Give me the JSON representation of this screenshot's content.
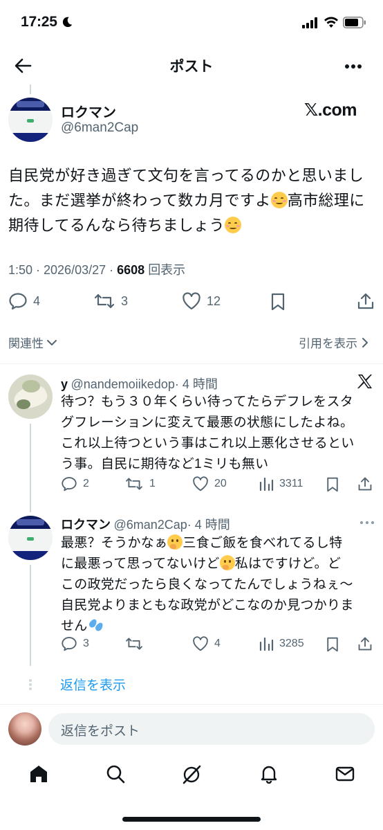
{
  "status_bar": {
    "time": "17:25"
  },
  "header": {
    "title": "ポスト"
  },
  "main_post": {
    "display_name": "ロクマン",
    "handle": "@6man2Cap",
    "source_label": "𝕏.com",
    "text_line1": "自民党が好き過ぎて文句を言ってるのかと思いまし",
    "text_line2a": "た。まだ選挙が終わって数カ月ですよ",
    "text_line2b": "高市総理に",
    "text_line3a": "期待してるんなら待ちましょう",
    "time": "1:50 · 2026/03/27 · ",
    "views_count": "6608",
    "views_label": "回表示",
    "replies": "4",
    "reposts": "3",
    "likes": "12"
  },
  "sort": {
    "relevance_label": "関連性",
    "quotes_label": "引用を表示"
  },
  "reply1": {
    "display_name": "y",
    "handle": "@nandemoiikedop",
    "time": "· 4 時間",
    "lines": [
      "待つ？もう３０年くらい待ってたらデフレをスタ",
      "グフレーションに変えて最悪の状態にしたよね。",
      "これ以上待つという事はこれ以上悪化させるとい",
      "う事。自民に期待など1ミリも無い"
    ],
    "replies": "2",
    "reposts": "1",
    "likes": "20",
    "views": "3311"
  },
  "reply2": {
    "display_name": "ロクマン",
    "handle": "@6man2Cap",
    "time": "· 4 時間",
    "line1a": "最悪？そうかなぁ",
    "line1b": "三食ご飯を食べれてるし特",
    "line2a": "に最悪って思ってないけど",
    "line2b": "私はですけど。ど",
    "line3": "この政党だったら良くなってたんでしょうねぇ～",
    "line4": "自民党よりまともな政党がどこなのか見つかりま",
    "line5": "せん",
    "replies": "3",
    "likes": "4",
    "views": "3285"
  },
  "show_replies": "返信を表示",
  "compose": {
    "placeholder": "返信をポスト"
  },
  "colors": {
    "accent": "#1d9bf0",
    "secondary_text": "#536471",
    "primary_text": "#0f1419"
  }
}
